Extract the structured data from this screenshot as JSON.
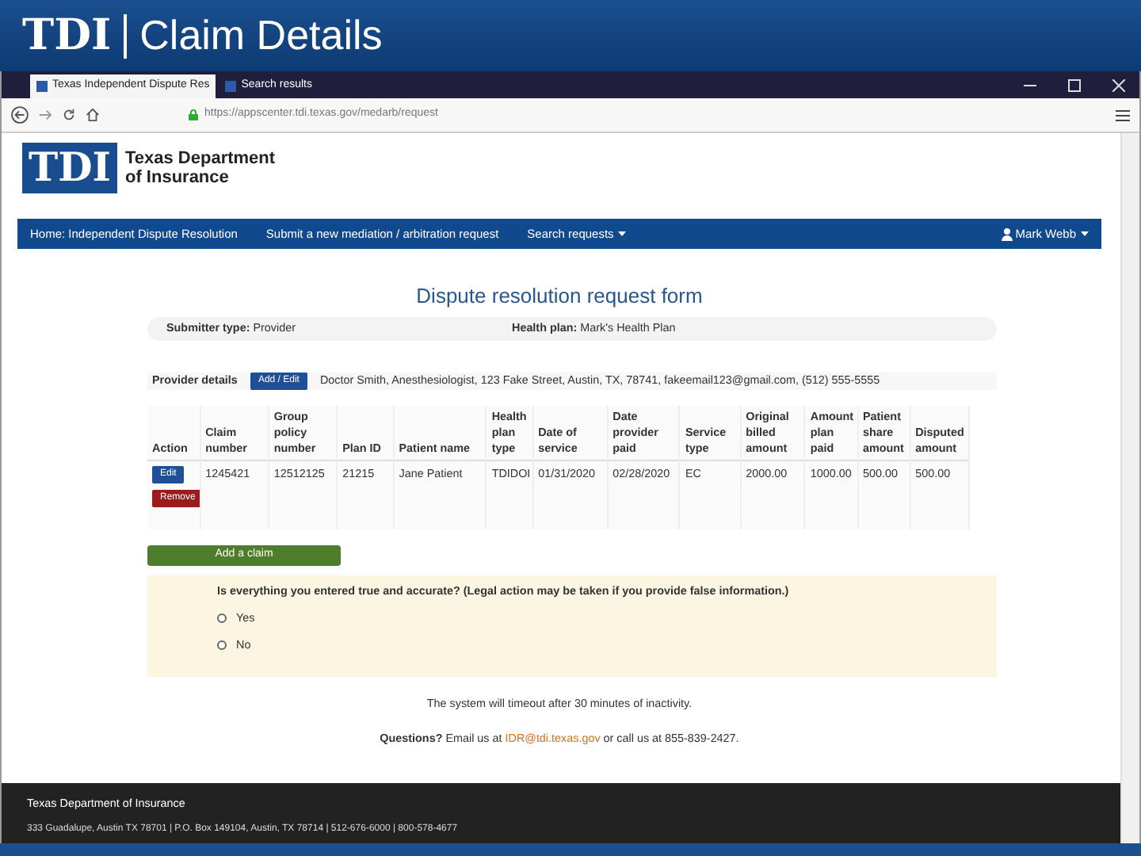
{
  "slide": {
    "logo": "TDI",
    "title": "Claim Details"
  },
  "browser": {
    "tabs": [
      {
        "label": "Texas Independent Dispute Res",
        "selected": true
      },
      {
        "label": "Search results",
        "selected": false
      }
    ],
    "url": "https://appscenter.tdi.texas.gov/medarb/request"
  },
  "page": {
    "logo": {
      "mark": "TDI",
      "name_lines": [
        "Texas Department",
        "of Insurance"
      ]
    },
    "nav": {
      "items": [
        "Home: Independent Dispute Resolution",
        "Submit a new mediation / arbitration request",
        "Search requests"
      ],
      "user": "Mark Webb"
    },
    "heading": "Dispute resolution request form",
    "summary": [
      "**Submitter type:** Provider",
      "**Health plan:** Mark's Health Plan"
    ],
    "provider": {
      "label": "Provider details",
      "button": "Add / Edit",
      "text": "Doctor Smith, Anesthesiologist, 123 Fake Street, Austin, TX, 78741, fakeemail123@gmail.com, (512) 555-5555"
    },
    "table": {
      "action_column": "Action",
      "columns": [
        "Claim number",
        "Group policy number",
        "Plan ID",
        "Patient name",
        "Health plan type",
        "Date of service",
        "Date provider paid",
        "Service type",
        "Original billed amount",
        "Amount plan paid",
        "Patient share amount",
        "Disputed amount"
      ],
      "rows": [
        {
          "actions": [
            "Edit",
            "Remove"
          ],
          "cells": [
            "1245421",
            "12512125",
            "21215",
            "Jane Patient",
            "TDIDOI",
            "01/31/2020",
            "02/28/2020",
            "EC",
            "2000.00",
            "1000.00",
            "500.00",
            "500.00"
          ]
        }
      ]
    },
    "add_button": "Add a claim",
    "attestation": {
      "question": "Is everything you entered true and accurate? (Legal action may be taken if you provide false information.)",
      "options": [
        {
          "label": "Yes",
          "selected": false
        },
        {
          "label": "No",
          "selected": false
        }
      ]
    },
    "timeout": "The system will timeout after 30 minutes of inactivity.",
    "contact": {
      "before": "**Questions?** Email us at",
      "link": "IDR@tdi.texas.gov",
      "after": "or call us at 855-839-2427."
    },
    "footer": [
      "Texas Department of Insurance",
      "333 Guadalupe, Austin TX 78701 | P.O. Box 149104, Austin, TX 78714 | 512-676-6000 | 800-578-4677"
    ]
  }
}
